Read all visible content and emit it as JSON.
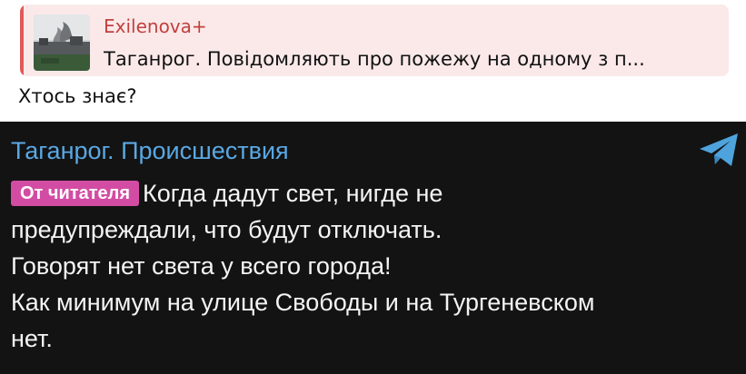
{
  "reply": {
    "author": "Exilenova+",
    "text": "Таганрог. Повідомляють про пожежу на одному з п...",
    "accent_color": "#e05a5a"
  },
  "message": {
    "text": "Хтось знає?"
  },
  "post": {
    "channel_name": "Таганрог. Происшествия",
    "badge": "От читателя",
    "badge_color": "#d34ca4",
    "lines": [
      "Когда дадут свет, нигде не",
      "предупреждали, что будут отключать.",
      "Говорят нет света у всего города!",
      "Как минимум на улице Свободы и на Тургеневском",
      "нет."
    ],
    "icon": "telegram-icon",
    "channel_color": "#5aa8e4"
  }
}
